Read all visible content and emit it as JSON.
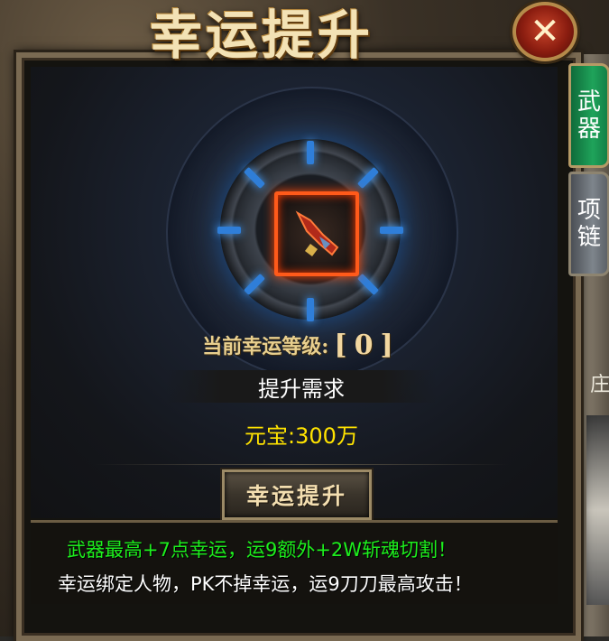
{
  "title": "幸运提升",
  "close_icon": "close-icon",
  "tabs": [
    {
      "label_line1": "武",
      "label_line2": "器",
      "active": true
    },
    {
      "label_line1": "项",
      "label_line2": "链",
      "active": false
    }
  ],
  "luck": {
    "level_label": "当前幸运等级:",
    "level_value": "[0]"
  },
  "requirement": {
    "title": "提升需求",
    "cost": "元宝:300万"
  },
  "upgrade_button": "幸运提升",
  "info": {
    "line1": "武器最高+7点幸运，运9额外+2W斩魂切割！",
    "line2": "幸运绑定人物，PK不掉幸运，运9刀刀最高攻击！"
  },
  "edge_text": "庄",
  "colors": {
    "green_text": "#1df01d",
    "cost_yellow": "#ffe300",
    "slot_glow": "#ff5a1a",
    "active_tab": "#1fa35a"
  }
}
